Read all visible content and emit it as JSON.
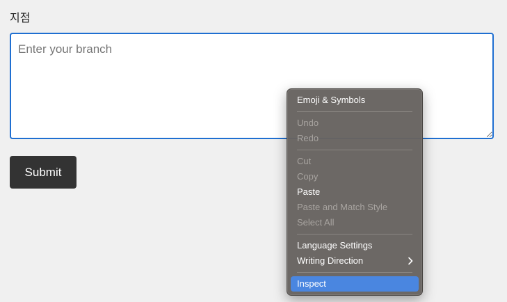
{
  "form": {
    "label": "지점",
    "placeholder": "Enter your branch",
    "value": "",
    "submit_label": "Submit"
  },
  "context_menu": {
    "groups": [
      [
        {
          "label": "Emoji & Symbols",
          "enabled": true
        }
      ],
      [
        {
          "label": "Undo",
          "enabled": false
        },
        {
          "label": "Redo",
          "enabled": false
        }
      ],
      [
        {
          "label": "Cut",
          "enabled": false
        },
        {
          "label": "Copy",
          "enabled": false
        },
        {
          "label": "Paste",
          "enabled": true
        },
        {
          "label": "Paste and Match Style",
          "enabled": false
        },
        {
          "label": "Select All",
          "enabled": false
        }
      ],
      [
        {
          "label": "Language Settings",
          "enabled": true
        },
        {
          "label": "Writing Direction",
          "enabled": true,
          "submenu": true
        }
      ],
      [
        {
          "label": "Inspect",
          "enabled": true,
          "highlighted": true
        }
      ]
    ]
  },
  "colors": {
    "focus_border": "#1f6fd1",
    "button_bg": "#333333",
    "menu_bg": "#676360",
    "menu_highlight": "#4a86e0"
  }
}
